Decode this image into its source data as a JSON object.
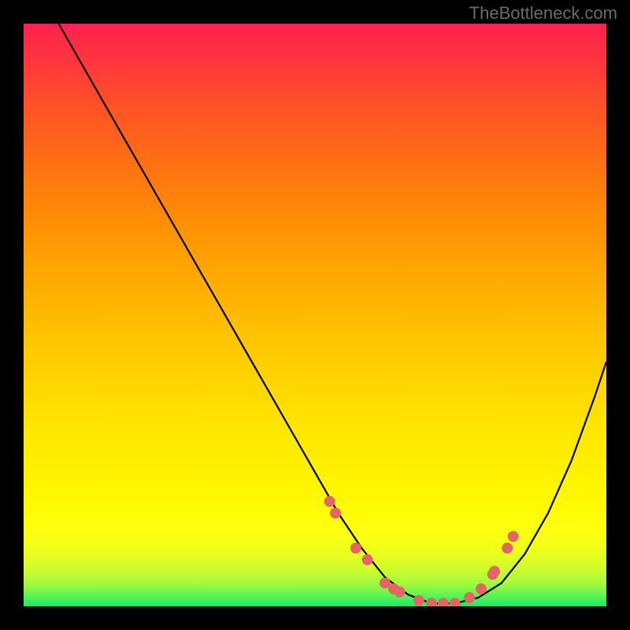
{
  "watermark": "TheBottleneck.com",
  "chart_data": {
    "type": "line",
    "title": "",
    "xlabel": "",
    "ylabel": "",
    "xlim": [
      0,
      100
    ],
    "ylim": [
      0,
      100
    ],
    "series": [
      {
        "name": "curve",
        "x": [
          6,
          10,
          14,
          18,
          22,
          26,
          30,
          34,
          38,
          42,
          46,
          50,
          54,
          58,
          62,
          66,
          70,
          74,
          78,
          82,
          86,
          90,
          94,
          98,
          100
        ],
        "y": [
          100,
          93,
          86,
          79,
          72,
          65,
          58,
          51,
          44,
          37,
          30,
          23,
          16,
          10,
          5,
          2,
          0.5,
          0.5,
          1.5,
          4,
          9,
          16,
          25,
          36,
          42
        ]
      },
      {
        "name": "markers",
        "x": [
          52.5,
          53.5,
          57,
          59,
          62,
          63.5,
          64.5,
          67.8,
          70,
          72,
          74,
          76.5,
          78.5,
          80.5,
          80.8,
          83,
          84
        ],
        "y": [
          18,
          16,
          10,
          8,
          4,
          3,
          2.5,
          1,
          0.5,
          0.5,
          0.5,
          1.5,
          3,
          5.5,
          6,
          10,
          12
        ]
      }
    ],
    "colors": {
      "curve": "#000000",
      "markers": "#e36666"
    }
  }
}
